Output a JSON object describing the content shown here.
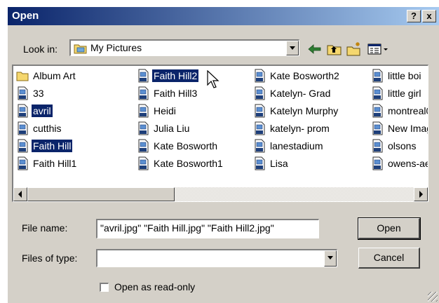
{
  "window": {
    "title": "Open",
    "help_label": "?",
    "close_label": "x"
  },
  "look_in": {
    "label": "Look in:",
    "value": "My Pictures",
    "icon": "folder-icon"
  },
  "toolbar": {
    "icons": [
      "back-arrow-icon",
      "up-one-level-icon",
      "new-folder-icon",
      "view-menu-icon"
    ]
  },
  "files": {
    "columns": [
      [
        {
          "name": "Album Art",
          "type": "folder",
          "selected": false
        },
        {
          "name": "33",
          "type": "image",
          "selected": false
        },
        {
          "name": "avril",
          "type": "image",
          "selected": true
        },
        {
          "name": "cutthis",
          "type": "image",
          "selected": false
        },
        {
          "name": "Faith Hill",
          "type": "image",
          "selected": true
        },
        {
          "name": "Faith Hill1",
          "type": "image",
          "selected": false
        }
      ],
      [
        {
          "name": "Faith Hill2",
          "type": "image",
          "selected": true
        },
        {
          "name": "Faith Hill3",
          "type": "image",
          "selected": false
        },
        {
          "name": "Heidi",
          "type": "image",
          "selected": false
        },
        {
          "name": "Julia Liu",
          "type": "image",
          "selected": false
        },
        {
          "name": "Kate Bosworth",
          "type": "image",
          "selected": false
        },
        {
          "name": "Kate Bosworth1",
          "type": "image",
          "selected": false
        }
      ],
      [
        {
          "name": "Kate Bosworth2",
          "type": "image",
          "selected": false
        },
        {
          "name": "Katelyn- Grad",
          "type": "image",
          "selected": false
        },
        {
          "name": "Katelyn Murphy",
          "type": "image",
          "selected": false
        },
        {
          "name": "katelyn- prom",
          "type": "image",
          "selected": false
        },
        {
          "name": "lanestadium",
          "type": "image",
          "selected": false
        },
        {
          "name": "Lisa",
          "type": "image",
          "selected": false
        }
      ],
      [
        {
          "name": "little boi",
          "type": "image",
          "selected": false
        },
        {
          "name": "little girl",
          "type": "image",
          "selected": false
        },
        {
          "name": "montreal0",
          "type": "image",
          "selected": false
        },
        {
          "name": "New Imag",
          "type": "image",
          "selected": false
        },
        {
          "name": "olsons",
          "type": "image",
          "selected": false
        },
        {
          "name": "owens-ae",
          "type": "image",
          "selected": false
        }
      ]
    ]
  },
  "file_name": {
    "label": "File name:",
    "value": "\"avril.jpg\" \"Faith Hill.jpg\" \"Faith Hill2.jpg\""
  },
  "files_of_type": {
    "label": "Files of type:",
    "value": ""
  },
  "buttons": {
    "open": "Open",
    "cancel": "Cancel"
  },
  "read_only": {
    "label": "Open as read-only",
    "checked": false
  },
  "colors": {
    "title_bar_start": "#0a246a",
    "title_bar_end": "#a6caf0",
    "selection": "#0a246a",
    "dialog_bg": "#d4d0c8"
  }
}
